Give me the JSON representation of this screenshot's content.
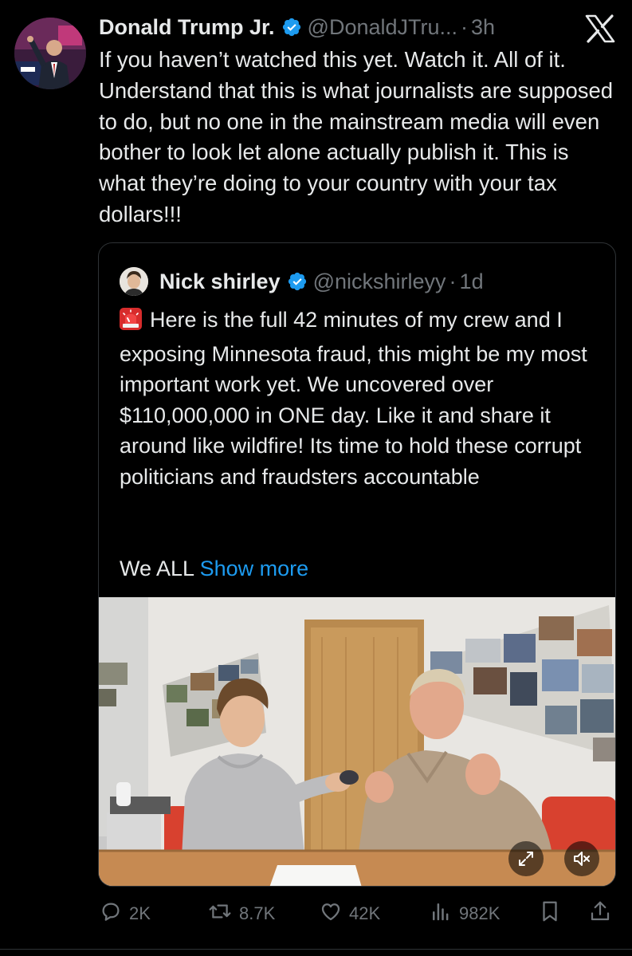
{
  "tweet": {
    "author_name": "Donald Trump Jr.",
    "author_handle": "@DonaldJTru...",
    "separator": "·",
    "time": "3h",
    "text": "If you haven’t watched this yet. Watch it. All of it. Understand that this is what journalists are supposed to do, but no one in the mainstream media will even bother to look let alone actually publish it. This is what they’re doing to your country with your tax dollars!!!"
  },
  "quote": {
    "author_name": "Nick shirley",
    "author_handle": "@nickshirleyy",
    "separator": "·",
    "time": "1d",
    "text": "Here is the full 42 minutes of my crew and I exposing Minnesota fraud, this might be my most important work yet. We uncovered over $110,000,000 in ONE day. Like it and share it around like wildfire! Its time to hold these corrupt politicians and fraudsters accountable",
    "truncated_text": "We ALL",
    "show_more": "Show more"
  },
  "actions": {
    "replies": "2K",
    "reposts": "8.7K",
    "likes": "42K",
    "views": "982K"
  },
  "colors": {
    "background": "#000000",
    "text": "#e7e9ea",
    "muted": "#71767b",
    "link": "#1d9bf0",
    "verified": "#1d9bf0",
    "border": "#2f3336"
  },
  "icons": {
    "verified": "verified-badge-icon",
    "platform": "x-logo-icon",
    "emoji": "siren-emoji-icon",
    "reply": "reply-icon",
    "repost": "repost-icon",
    "like": "heart-icon",
    "views": "views-chart-icon",
    "bookmark": "bookmark-icon",
    "share": "share-icon",
    "expand": "expand-icon",
    "mute": "mute-icon"
  }
}
